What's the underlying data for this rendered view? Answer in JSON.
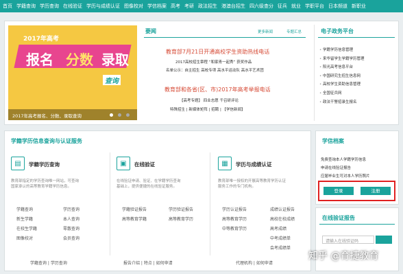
{
  "nav": [
    "首页",
    "学籍查询",
    "学历查询",
    "在线验证",
    "学历与成绩认证",
    "图像校对",
    "学信档案",
    "高考",
    "考研",
    "政法招生",
    "港澳台招生",
    "四六级查分",
    "征兵",
    "就业",
    "学职平台",
    "日本频道",
    "新职业"
  ],
  "banner": {
    "year_title": "2017年高考",
    "words": [
      "报名",
      "分数",
      "录取"
    ],
    "query": "查询",
    "caption": "2017年高考报名、分数、录取查询"
  },
  "news": {
    "title": "要闻",
    "more": "更多新闻",
    "topics": "专题汇总",
    "headline1": "教育部7月21日开通高校学生资助热线电话",
    "sub1": "2017高校招生章程   “和家青一起秀” 获奖作品",
    "sub2": "名单公示：自主招生  高校专项  高水平运动队  高水平艺术团",
    "headline2": "教育部和各省(区、市)2017年高考举报电话",
    "sub3": "【高考专题】  四业志愿  千召研评论",
    "sub4": "特殊招生  |  新媒体矩阵  |  招聘  |  【学信新闻】"
  },
  "gov": {
    "title": "电子政务平台",
    "items": [
      "学籍学历信息管理",
      "来华留学生学籍学历管理",
      "阳光高考信息平台",
      "中国研究生招生信息网",
      "高校学生资助信息管理",
      "全国征兵网",
      "政法干警招录生报名"
    ]
  },
  "section": {
    "title": "学籍学历信息查询与认证服务",
    "archive_title": "学信档案",
    "archive_desc1": "免费查询本人学籍学历信息",
    "archive_desc2": "申请在线验证报告",
    "archive_desc3": "应届毕业生可对本人学历照片",
    "login": "登录",
    "register": "注册",
    "verify_title": "在线验证报告",
    "verify_placeholder": "请输入在线验证码"
  },
  "col1": {
    "title": "学籍学历查询",
    "desc": [
      "教育部指定的学历查询唯一网站，可查询",
      "国家承认的高等教育学籍学历信息。"
    ],
    "links_left": [
      "学籍查询",
      "新生学籍",
      "在校生学籍",
      "图像校对"
    ],
    "links_right": [
      "学历查询",
      "本人查询",
      "零散查询",
      "会员查询"
    ],
    "foot": "学籍查询   |   学历查询"
  },
  "col2": {
    "title": "在线验证",
    "desc": [
      "在线验证申请、验证、在学籍学历查询",
      "基础上，提供便捷的在线验证服务。"
    ],
    "links_left": [
      "学籍验证报告",
      "高等教育学籍"
    ],
    "links_right": [
      "学历验证报告",
      "高等教育学历"
    ],
    "foot": "报告介绍   |   特点   |   如何申请"
  },
  "col3": {
    "title": "学历与成绩认证",
    "desc": [
      "教育部唯一授权的开展高等教育学历认证",
      "服务工作的专门机构。"
    ],
    "links_left": [
      "学历认证报告",
      "高等教育学历",
      "中等教育学历"
    ],
    "links_right": [
      "成绩认证报告",
      "高校在校成绩",
      "高考成绩",
      "中考成绩单",
      "会考成绩单"
    ],
    "foot": "代理机构   |   如何申请"
  },
  "watermark": "知乎 @育捷教育",
  "colors": {
    "accent": "#1aa39c",
    "red": "#d64a35",
    "banner": "#f5c842",
    "pink": "#e8458f"
  }
}
